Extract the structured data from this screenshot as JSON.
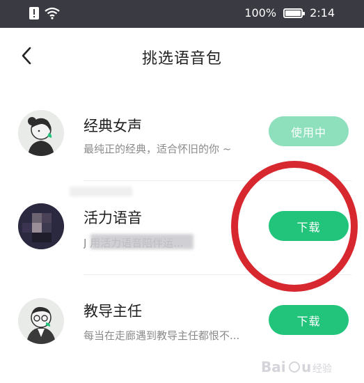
{
  "status_bar": {
    "battery_percent": "100%",
    "time": "2:14",
    "icons": [
      "notification-icon",
      "wifi-icon",
      "battery-icon"
    ]
  },
  "header": {
    "title": "挑选语音包",
    "back_icon": "chevron-left-icon"
  },
  "voice_packs": [
    {
      "name": "经典女声",
      "description": "最纯正的经典，适合怀旧的你 ~",
      "button": "使用中"
    },
    {
      "name": "活力语音",
      "description": "J                    用活力语音陪伴运...",
      "button": "下载"
    },
    {
      "name": "教导主任",
      "description": "每当在走廊遇到教导主任都恨不...",
      "button": "下载"
    }
  ],
  "colors": {
    "status_bar_bg": "#3a3a42",
    "active_button": "#8ee0bd",
    "download_button": "#22c47b",
    "annotation": "#d8282f"
  }
}
